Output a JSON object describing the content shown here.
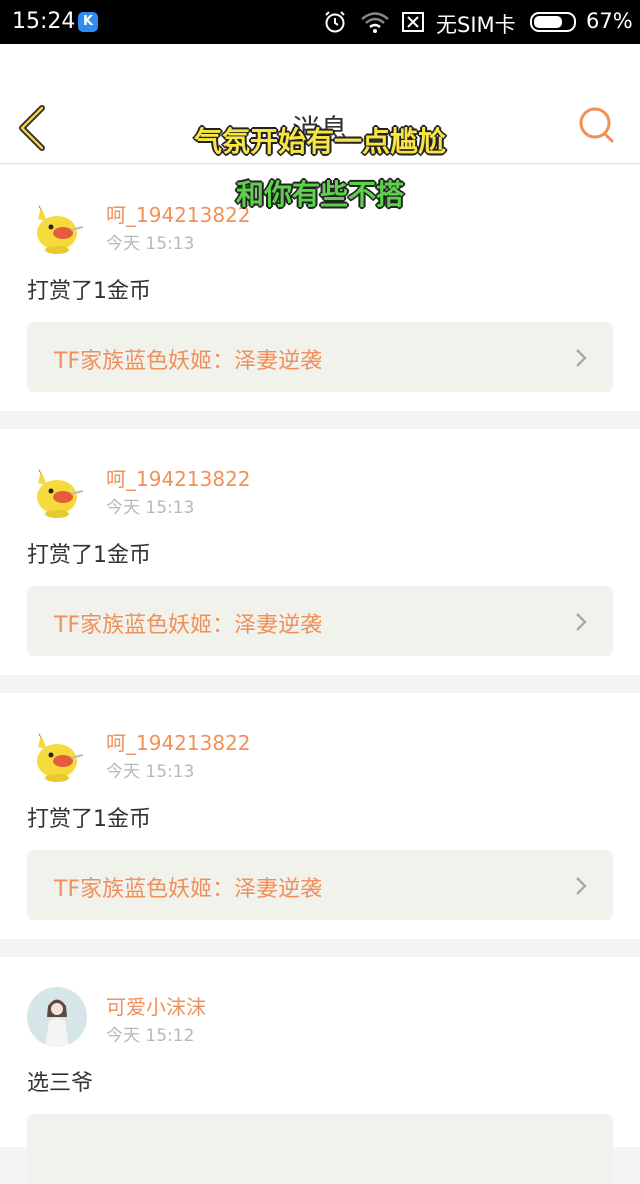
{
  "status_bar": {
    "time": "15:24",
    "app_badge": "K",
    "carrier": "无SIM卡",
    "battery_percent": "67%",
    "icons": [
      "k-app-icon",
      "alarm-icon",
      "wifi-icon",
      "no-sim-icon",
      "battery-icon"
    ]
  },
  "navbar": {
    "title": "消息",
    "back_icon": "chevron-left-icon",
    "search_icon": "search-icon",
    "accent_color": "#f0905a"
  },
  "captions": [
    "气氛开始有一点尴尬",
    "和你有些不搭"
  ],
  "messages": [
    {
      "username": "呵_194213822",
      "time": "今天 15:13",
      "content": "打赏了1金币",
      "link": "TF家族蓝色妖姬：泽妻逆袭",
      "avatar": "pikachu-avatar"
    },
    {
      "username": "呵_194213822",
      "time": "今天 15:13",
      "content": "打赏了1金币",
      "link": "TF家族蓝色妖姬：泽妻逆袭",
      "avatar": "pikachu-avatar"
    },
    {
      "username": "呵_194213822",
      "time": "今天 15:13",
      "content": "打赏了1金币",
      "link": "TF家族蓝色妖姬：泽妻逆袭",
      "avatar": "pikachu-avatar"
    },
    {
      "username": "可爱小沫沫",
      "time": "今天 15:12",
      "content": "选三爷",
      "link": "",
      "avatar": "girl-photo-avatar"
    }
  ]
}
